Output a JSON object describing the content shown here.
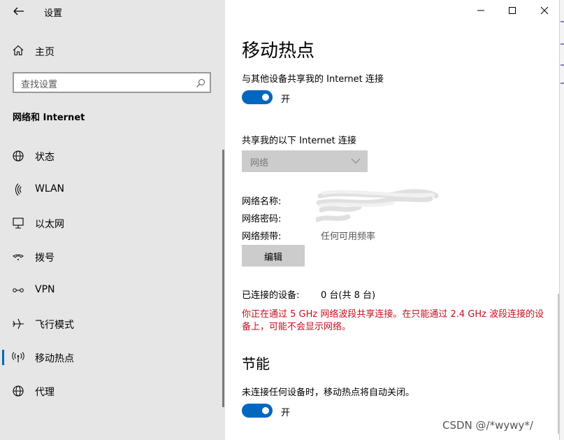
{
  "window": {
    "title": "设置",
    "back_icon": "back-arrow-icon",
    "controls": [
      "minimize-icon",
      "maximize-icon",
      "close-icon"
    ]
  },
  "sidebar": {
    "home_label": "主页",
    "search_placeholder": "查找设置",
    "section_title": "网络和 Internet",
    "items": [
      {
        "label": "状态",
        "icon": "globe-status-icon",
        "selected": false
      },
      {
        "label": "WLAN",
        "icon": "wifi-icon",
        "selected": false
      },
      {
        "label": "以太网",
        "icon": "ethernet-icon",
        "selected": false
      },
      {
        "label": "拨号",
        "icon": "dialup-icon",
        "selected": false
      },
      {
        "label": "VPN",
        "icon": "vpn-icon",
        "selected": false
      },
      {
        "label": "飞行模式",
        "icon": "airplane-icon",
        "selected": false
      },
      {
        "label": "移动热点",
        "icon": "hotspot-icon",
        "selected": true
      },
      {
        "label": "代理",
        "icon": "globe-proxy-icon",
        "selected": false
      }
    ]
  },
  "main": {
    "title": "移动热点",
    "share_label": "与其他设备共享我的 Internet 连接",
    "share_toggle": {
      "state": "开",
      "on": true
    },
    "share_from_label": "共享我的以下 Internet 连接",
    "share_from_value": "网络",
    "network_name_label": "网络名称:",
    "network_password_label": "网络密码:",
    "network_band_label": "网络频带:",
    "network_band_value": "任何可用频率",
    "edit_button": "编辑",
    "connected_label": "已连接的设备:",
    "connected_value": "0 台(共 8 台)",
    "warning": "你正在通过 5 GHz 网络波段共享连接。在只能通过 2.4 GHz 波段连接的设备上，可能不会显示网络。",
    "power_title": "节能",
    "power_desc": "未连接任何设备时，移动热点将自动关闭。",
    "power_toggle": {
      "state": "开",
      "on": true
    }
  },
  "watermark": "CSDN @/*wywy*/",
  "colors": {
    "accent": "#0067c0",
    "warning": "#c50f1f",
    "sidebar_bg": "#e6e6e6"
  }
}
